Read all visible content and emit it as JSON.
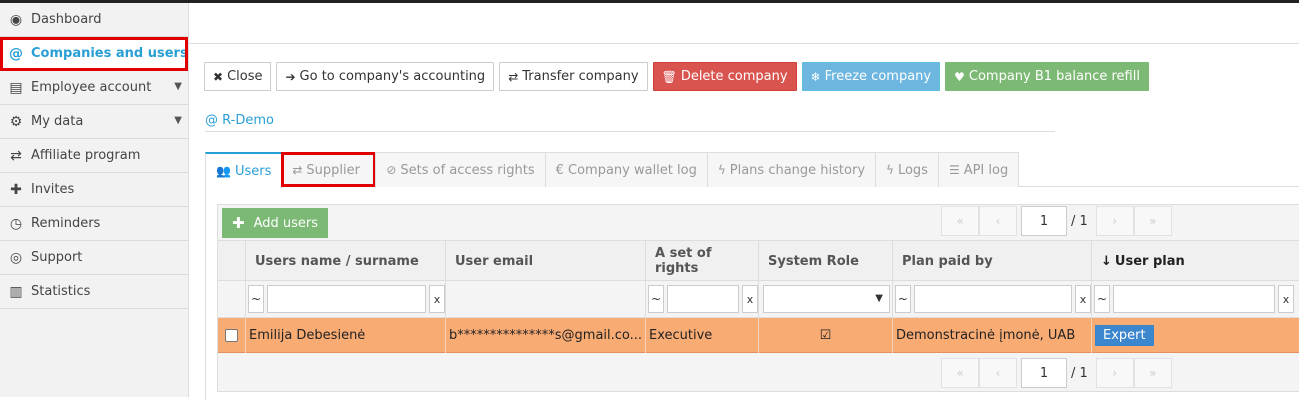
{
  "sidebar": {
    "items": [
      {
        "label": "Dashboard",
        "icon": "dashboard-icon",
        "glyph": "◉"
      },
      {
        "label": "Companies and users",
        "icon": "at-icon",
        "glyph": "@"
      },
      {
        "label": "Employee account",
        "icon": "id-card-icon",
        "glyph": "▤"
      },
      {
        "label": "My data",
        "icon": "gears-icon",
        "glyph": "⚙"
      },
      {
        "label": "Affiliate program",
        "icon": "handshake-icon",
        "glyph": "⇄"
      },
      {
        "label": "Invites",
        "icon": "user-plus-icon",
        "glyph": "👤"
      },
      {
        "label": "Reminders",
        "icon": "clock-icon",
        "glyph": "◷"
      },
      {
        "label": "Support",
        "icon": "lifebuoy-icon",
        "glyph": "◎"
      },
      {
        "label": "Statistics",
        "icon": "bar-chart-icon",
        "glyph": "▥"
      }
    ]
  },
  "toolbar": {
    "close": "Close",
    "accounting": "Go to company's accounting",
    "transfer": "Transfer company",
    "delete": "Delete company",
    "freeze": "Freeze company",
    "refill": "Company B1 balance refill"
  },
  "company": {
    "name": "R-Demo"
  },
  "tabs": [
    "Users",
    "Supplier",
    "Sets of access rights",
    "€ Company wallet log",
    "Plans change history",
    "Logs",
    "API log"
  ],
  "grid": {
    "add_label": "Add users",
    "page": "1",
    "total": "/ 1",
    "columns": [
      "Users name / surname",
      "User email",
      "A set of rights",
      "System Role",
      "Plan paid by",
      "User plan"
    ],
    "filter_tilde": "~",
    "filter_clear": "x",
    "rows": [
      {
        "name": "Emilija Debesienė",
        "email": "b***************s@gmail.co...",
        "rights": "Executive",
        "role_checked": "☑",
        "paid_by": "Demonstracinė įmonė, UAB",
        "plan": "Expert"
      }
    ]
  },
  "colors": {
    "accent": "#2a9fd6",
    "row_highlight": "#f9ab74",
    "red": "#d9534f",
    "green": "#7cb974",
    "blue": "#6cb6e0"
  }
}
